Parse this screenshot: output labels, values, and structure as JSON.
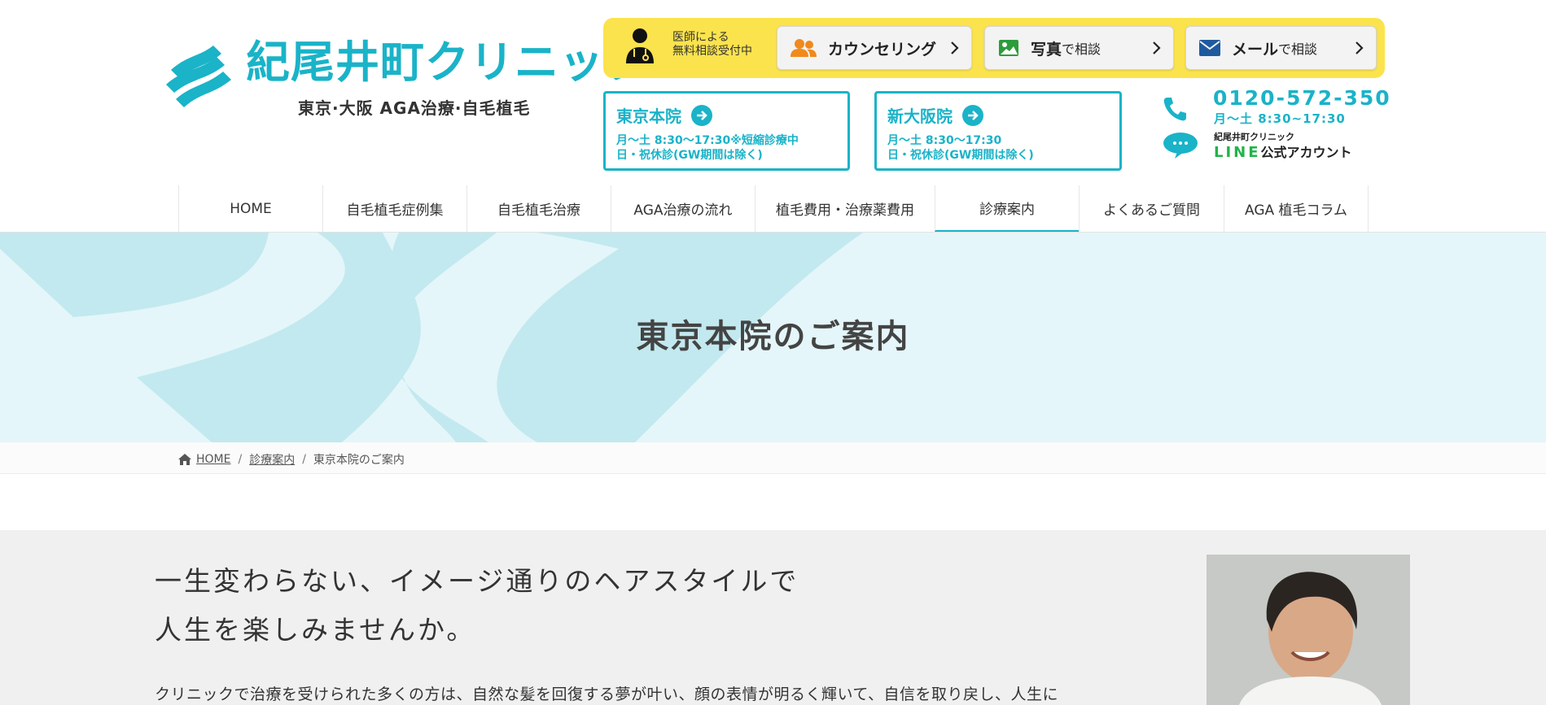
{
  "logo": {
    "name": "紀尾井町クリニック",
    "subtitle": "東京·大阪  AGA治療·自毛植毛"
  },
  "consult": {
    "note_line1": "医師による",
    "note_line2": "無料相談受付中",
    "buttons": [
      {
        "main": "カウンセリング",
        "suffix": "",
        "icon": "people-icon"
      },
      {
        "main": "写真",
        "suffix": "で相談",
        "icon": "photo-icon"
      },
      {
        "main": "メール",
        "suffix": "で相談",
        "icon": "mail-icon"
      }
    ]
  },
  "clinics": [
    {
      "name": "東京本院",
      "hours1": "月〜土 8:30〜17:30※短縮診療中",
      "hours2": "日・祝休診(GW期間は除く)"
    },
    {
      "name": "新大阪院",
      "hours1": "月〜土 8:30〜17:30",
      "hours2": "日・祝休診(GW期間は除く)"
    }
  ],
  "contact": {
    "phone": "0120-572-350",
    "phone_hours": "月〜土 8:30~17:30",
    "line_clinic": "紀尾井町クリニック",
    "line_word": "LINE",
    "line_rest": "公式アカウント"
  },
  "nav": {
    "items": [
      {
        "label": "HOME",
        "width": 177
      },
      {
        "label": "自毛植毛症例集",
        "width": 177
      },
      {
        "label": "自毛植毛治療",
        "width": 177
      },
      {
        "label": "AGA治療の流れ",
        "width": 177
      },
      {
        "label": "植毛費用・治療薬費用",
        "width": 221
      },
      {
        "label": "診療案内",
        "width": 177
      },
      {
        "label": "よくあるご質問",
        "width": 178
      },
      {
        "label": "AGA 植毛コラム",
        "width": 178
      }
    ],
    "active": "診療案内"
  },
  "hero": {
    "title": "東京本院のご案内"
  },
  "breadcrumb": {
    "home": "HOME",
    "parent": "診療案内",
    "current": "東京本院のご案内",
    "separator": "/"
  },
  "intro": {
    "heading_line1": "一生変わらない、イメージ通りのヘアスタイルで",
    "heading_line2": "人生を楽しみませんか。",
    "body": "クリニックで治療を受けられた多くの方は、自然な髪を回復する夢が叶い、顔の表情が明るく輝いて、自信を取り戻し、人生に"
  },
  "colors": {
    "accent": "#1ab3c8",
    "yellow": "#fbe34d",
    "hero_bg": "#e4f6f9",
    "hero_shape": "#c2e9ef",
    "line_green": "#22b34a",
    "intro_bg": "#f1f0f0"
  }
}
